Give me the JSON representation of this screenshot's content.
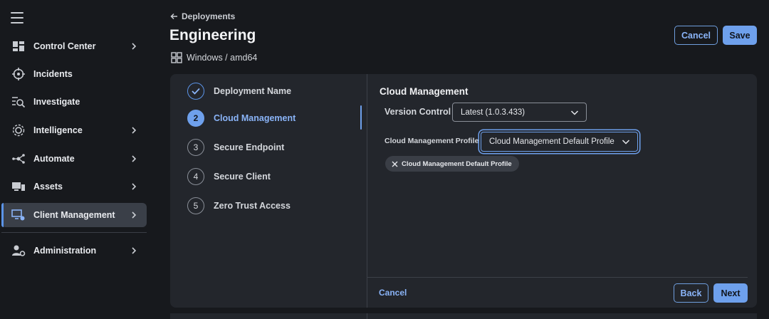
{
  "sidebar": {
    "items": [
      {
        "label": "Control Center",
        "icon": "dashboard-icon",
        "has_chevron": true
      },
      {
        "label": "Incidents",
        "icon": "crosshair-icon",
        "has_chevron": false
      },
      {
        "label": "Investigate",
        "icon": "investigate-icon",
        "has_chevron": false
      },
      {
        "label": "Intelligence",
        "icon": "intelligence-icon",
        "has_chevron": true
      },
      {
        "label": "Automate",
        "icon": "automate-icon",
        "has_chevron": true
      },
      {
        "label": "Assets",
        "icon": "assets-icon",
        "has_chevron": true
      },
      {
        "label": "Client Management",
        "icon": "client-management-icon",
        "has_chevron": true,
        "active": true
      },
      {
        "label": "Administration",
        "icon": "administration-icon",
        "has_chevron": true
      }
    ]
  },
  "header": {
    "back_label": "Deployments",
    "title": "Engineering",
    "platform": "Windows / amd64",
    "cancel_label": "Cancel",
    "save_label": "Save"
  },
  "steps": [
    {
      "number": "1",
      "label": "Deployment Name",
      "state": "done"
    },
    {
      "number": "2",
      "label": "Cloud Management",
      "state": "current"
    },
    {
      "number": "3",
      "label": "Secure Endpoint",
      "state": "pending"
    },
    {
      "number": "4",
      "label": "Secure Client",
      "state": "pending"
    },
    {
      "number": "5",
      "label": "Zero Trust Access",
      "state": "pending"
    }
  ],
  "form": {
    "section_title": "Cloud Management",
    "version_control_label": "Version Control",
    "version_control_value": "Latest (1.0.3.433)",
    "profile_label": "Cloud Management Profile",
    "profile_value": "Cloud Management Default Profile",
    "selected_chip": "Cloud Management Default Profile"
  },
  "footer": {
    "cancel_label": "Cancel",
    "back_label": "Back",
    "next_label": "Next"
  },
  "colors": {
    "accent": "#6ea0ec",
    "background": "#17191d",
    "card": "#23262c"
  }
}
